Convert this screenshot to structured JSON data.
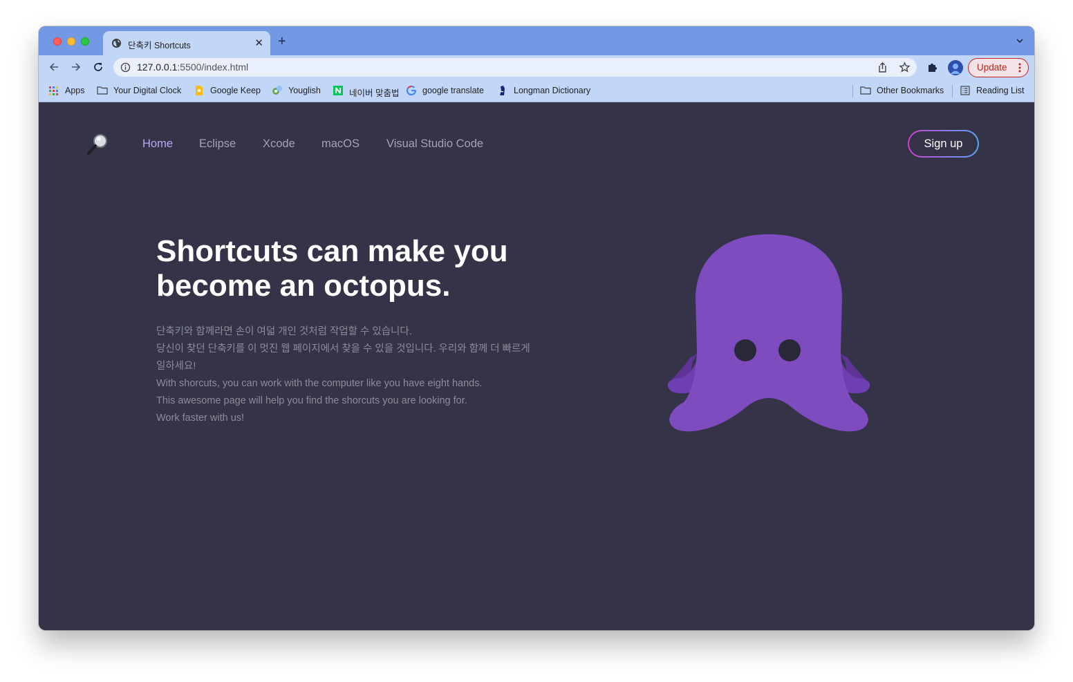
{
  "browser": {
    "tab": {
      "title": "단축키 Shortcuts",
      "close": "✕"
    },
    "new_tab": "+",
    "url_host": "127.0.0.1",
    "url_rest": ":5500/index.html",
    "update_label": "Update",
    "bookmarks": [
      {
        "label": "Apps",
        "icon": "apps-grid-icon"
      },
      {
        "label": "Your Digital Clock",
        "icon": "folder-icon"
      },
      {
        "label": "Google Keep",
        "icon": "google-keep-icon"
      },
      {
        "label": "Youglish",
        "icon": "youglish-icon"
      },
      {
        "label": "네이버 맞춤법",
        "icon": "naver-icon"
      },
      {
        "label": "google translate",
        "icon": "google-icon"
      },
      {
        "label": "Longman Dictionary",
        "icon": "longman-icon"
      }
    ],
    "other_bookmarks": "Other Bookmarks",
    "reading_list": "Reading List"
  },
  "site": {
    "nav": [
      {
        "label": "Home",
        "active": true
      },
      {
        "label": "Eclipse",
        "active": false
      },
      {
        "label": "Xcode",
        "active": false
      },
      {
        "label": "macOS",
        "active": false
      },
      {
        "label": "Visual Studio Code",
        "active": false
      }
    ],
    "signup_label": "Sign up",
    "headline_line1": "Shortcuts can make you",
    "headline_line2": "become an octopus.",
    "description": [
      "단축키와 함께라면 손이 여덟 개인 것처럼 작업할 수 있습니다.",
      "당신이 찾던 단축키를 이 멋진 웹 페이지에서 찾을 수 있을 것입니다. 우리와 함께 더 빠르게",
      "일하세요!",
      "With shorcuts, you can work with the computer like you have eight hands.",
      "This awesome page will help you find the shorcuts you are looking for.",
      "Work faster with us!"
    ]
  },
  "colors": {
    "background": "#343348",
    "accent": "#b9a8f6",
    "octopus": "#7e4cbf",
    "signup_gradient": [
      "#d03fd0",
      "#5aa8f4"
    ]
  }
}
